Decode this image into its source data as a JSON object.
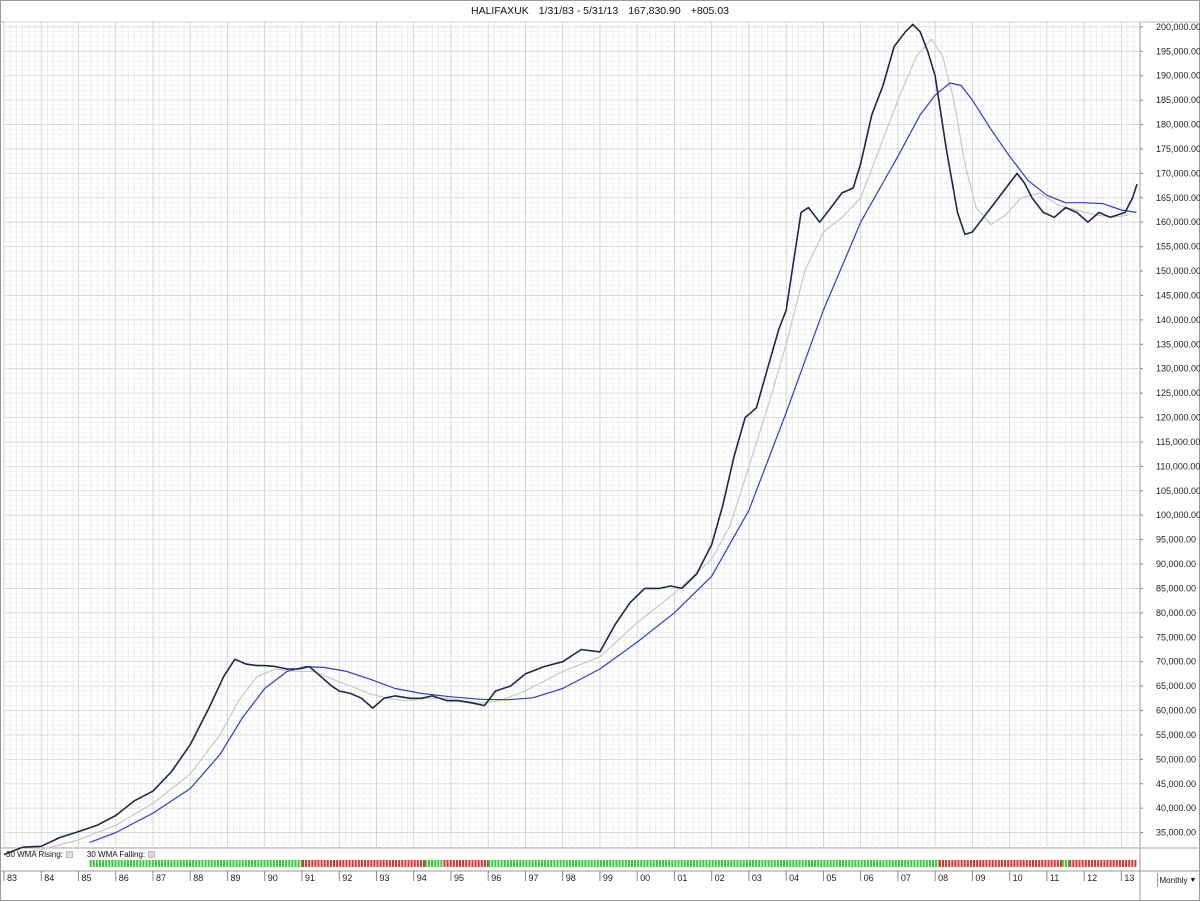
{
  "header": {
    "symbol": "HALIFAXUK",
    "date_range": "1/31/83 - 5/31/13",
    "last_value": "167,830.90",
    "change": "+805.03"
  },
  "legend": {
    "rising_label": "30 WMA Rising:",
    "falling_label": "30 WMA Falling:",
    "rising_color": "#33cc33",
    "falling_color": "#e03030"
  },
  "period_selector": {
    "label": "Monthly",
    "icon": "chevron-down-icon"
  },
  "chart_data": {
    "type": "line",
    "title": "",
    "ylim": [
      30000,
      201000
    ],
    "y_ticks": [
      "35,000.00",
      "40,000.00",
      "45,000.00",
      "50,000.00",
      "55,000.00",
      "60,000.00",
      "65,000.00",
      "70,000.00",
      "75,000.00",
      "80,000.00",
      "85,000.00",
      "90,000.00",
      "95,000.00",
      "100,000.00",
      "105,000.00",
      "110,000.00",
      "115,000.00",
      "120,000.00",
      "125,000.00",
      "130,000.00",
      "135,000.00",
      "140,000.00",
      "145,000.00",
      "150,000.00",
      "155,000.00",
      "160,000.00",
      "165,000.00",
      "170,000.00",
      "175,000.00",
      "180,000.00",
      "185,000.00",
      "190,000.00",
      "195,000.00",
      "200,000.00"
    ],
    "x_ticks": [
      "83",
      "84",
      "85",
      "86",
      "87",
      "88",
      "89",
      "90",
      "91",
      "92",
      "93",
      "94",
      "95",
      "96",
      "97",
      "98",
      "99",
      "00",
      "01",
      "02",
      "03",
      "04",
      "05",
      "06",
      "07",
      "08",
      "09",
      "10",
      "11",
      "12",
      "13"
    ],
    "grid": true,
    "series": [
      {
        "name": "",
        "color": "#1a2a4a",
        "width": 1.6,
        "x": [
          1983.0,
          1983.5,
          1984.0,
          1984.5,
          1985.0,
          1985.5,
          1986.0,
          1986.5,
          1987.0,
          1987.5,
          1988.0,
          1988.5,
          1988.9,
          1989.2,
          1989.5,
          1989.8,
          1990.0,
          1990.3,
          1990.6,
          1990.9,
          1991.2,
          1991.5,
          1991.8,
          1992.0,
          1992.3,
          1992.6,
          1992.9,
          1993.2,
          1993.5,
          1993.9,
          1994.2,
          1994.5,
          1994.9,
          1995.2,
          1995.6,
          1995.9,
          1996.2,
          1996.6,
          1997.0,
          1997.5,
          1998.0,
          1998.5,
          1999.0,
          1999.4,
          1999.8,
          2000.2,
          2000.6,
          2000.9,
          2001.2,
          2001.6,
          2002.0,
          2002.3,
          2002.6,
          2002.9,
          2003.2,
          2003.5,
          2003.8,
          2004.0,
          2004.2,
          2004.4,
          2004.6,
          2004.9,
          2005.2,
          2005.5,
          2005.8,
          2006.0,
          2006.3,
          2006.6,
          2006.9,
          2007.2,
          2007.4,
          2007.6,
          2007.8,
          2008.0,
          2008.3,
          2008.6,
          2008.8,
          2009.0,
          2009.2,
          2009.5,
          2009.8,
          2010.2,
          2010.4,
          2010.6,
          2010.9,
          2011.2,
          2011.5,
          2011.8,
          2012.1,
          2012.4,
          2012.7,
          2012.9,
          2013.1,
          2013.3,
          2013.42
        ],
        "values": [
          30500,
          32000,
          32200,
          34000,
          35200,
          36500,
          38500,
          41500,
          43500,
          47500,
          53000,
          60500,
          67000,
          70500,
          69500,
          69200,
          69200,
          69000,
          68500,
          68500,
          69000,
          67000,
          65000,
          64000,
          63500,
          62500,
          60500,
          62500,
          63000,
          62500,
          62500,
          63000,
          62000,
          62000,
          61500,
          61000,
          64000,
          65000,
          67500,
          69000,
          70000,
          72500,
          72000,
          77500,
          82000,
          85000,
          85000,
          85500,
          85000,
          88000,
          94000,
          102000,
          112000,
          120000,
          122000,
          130000,
          138000,
          142000,
          152000,
          162000,
          163000,
          160000,
          163000,
          166000,
          167000,
          172000,
          182000,
          188000,
          196000,
          199000,
          200500,
          199000,
          195000,
          190000,
          175000,
          162000,
          157500,
          158000,
          160000,
          163000,
          166000,
          170000,
          168000,
          165000,
          162000,
          161000,
          163000,
          162000,
          160000,
          162000,
          161000,
          161500,
          162000,
          165000,
          167800
        ]
      },
      {
        "name": "",
        "color": "#c8c8c8",
        "width": 1.2,
        "x": [
          1983.5,
          1984.0,
          1985.0,
          1986.0,
          1987.0,
          1988.0,
          1988.8,
          1989.3,
          1989.8,
          1990.3,
          1990.8,
          1991.3,
          1991.8,
          1992.3,
          1992.8,
          1993.3,
          1993.8,
          1994.3,
          1994.8,
          1995.3,
          1995.8,
          1996.3,
          1997.0,
          1998.0,
          1999.0,
          2000.0,
          2001.0,
          2002.0,
          2002.5,
          2003.0,
          2003.5,
          2004.0,
          2004.5,
          2005.0,
          2005.5,
          2006.0,
          2006.5,
          2007.0,
          2007.5,
          2007.9,
          2008.2,
          2008.5,
          2008.8,
          2009.1,
          2009.5,
          2009.9,
          2010.3,
          2010.8,
          2011.3,
          2011.8,
          2012.3,
          2012.8,
          2013.2
        ],
        "values": [
          31000,
          31500,
          33500,
          36500,
          41000,
          47000,
          55000,
          62000,
          67000,
          68500,
          68000,
          68000,
          66500,
          65000,
          63500,
          62500,
          62000,
          62500,
          62500,
          62000,
          61500,
          62000,
          64000,
          68000,
          71000,
          78000,
          84000,
          91000,
          98000,
          110000,
          122000,
          135000,
          150000,
          158000,
          161000,
          165000,
          175000,
          185000,
          194000,
          197500,
          194000,
          185000,
          172000,
          163000,
          159500,
          161500,
          165000,
          166000,
          163500,
          162500,
          161500,
          161000,
          161500
        ]
      },
      {
        "name": "",
        "color": "#2a3fd0",
        "width": 1.2,
        "x": [
          1985.3,
          1986.0,
          1987.0,
          1988.0,
          1988.8,
          1989.4,
          1990.0,
          1990.6,
          1991.1,
          1991.6,
          1992.2,
          1992.8,
          1993.5,
          1994.2,
          1995.0,
          1995.8,
          1996.5,
          1997.2,
          1998.0,
          1999.0,
          2000.0,
          2001.0,
          2002.0,
          2003.0,
          2004.0,
          2005.0,
          2006.0,
          2007.0,
          2007.6,
          2008.0,
          2008.4,
          2008.7,
          2009.0,
          2009.5,
          2010.0,
          2010.5,
          2011.0,
          2011.5,
          2012.0,
          2012.5,
          2013.0,
          2013.4
        ],
        "values": [
          33000,
          35000,
          39000,
          44000,
          51000,
          58500,
          64500,
          68000,
          69000,
          68800,
          68000,
          66500,
          64500,
          63500,
          62800,
          62300,
          62200,
          62600,
          64500,
          68500,
          74000,
          80000,
          87500,
          101000,
          121000,
          142000,
          160000,
          173500,
          182000,
          186000,
          188500,
          188000,
          185000,
          179000,
          173500,
          168500,
          165500,
          164000,
          164000,
          163800,
          162500,
          162000
        ]
      }
    ],
    "indicator_pattern": [
      {
        "from": 1985.3,
        "to": 1991.0,
        "state": "rising"
      },
      {
        "from": 1991.0,
        "to": 1994.3,
        "state": "falling"
      },
      {
        "from": 1994.3,
        "to": 1994.8,
        "state": "rising"
      },
      {
        "from": 1994.8,
        "to": 1996.0,
        "state": "falling"
      },
      {
        "from": 1996.0,
        "to": 2008.1,
        "state": "rising"
      },
      {
        "from": 2008.1,
        "to": 2011.4,
        "state": "falling"
      },
      {
        "from": 2011.4,
        "to": 2011.6,
        "state": "rising"
      },
      {
        "from": 2011.6,
        "to": 2013.4,
        "state": "falling"
      }
    ]
  }
}
